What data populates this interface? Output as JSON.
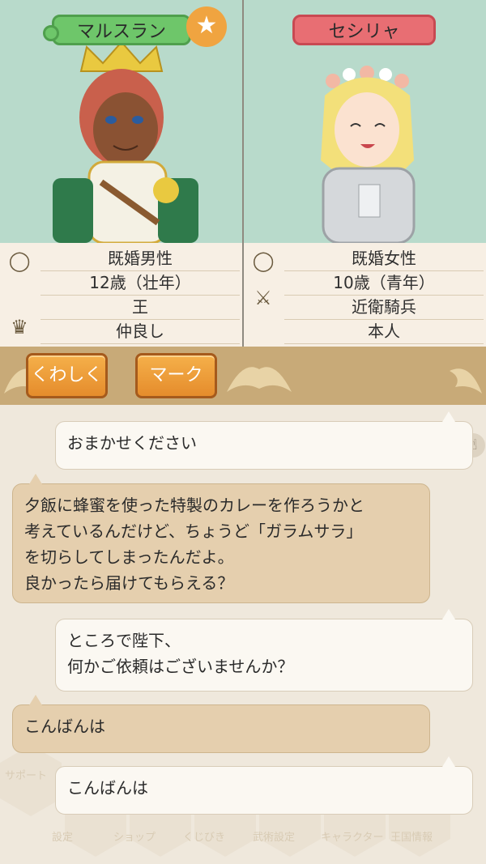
{
  "characters": {
    "left": {
      "name": "マルスラン",
      "badge": "★",
      "info": [
        "既婚男性",
        "12歳（壮年）",
        "王",
        "仲良し"
      ],
      "icons": [
        "ring-icon",
        "crown-icon"
      ]
    },
    "right": {
      "name": "セシリャ",
      "info": [
        "既婚女性",
        "10歳（青年）",
        "近衛騎兵",
        "本人"
      ],
      "icons": [
        "ring-icon",
        "crossed-swords-icon"
      ]
    }
  },
  "buttons": {
    "details": "くわしく",
    "mark": "マーク"
  },
  "chat": {
    "messages": [
      {
        "side": "right",
        "lines": [
          "おまかせください"
        ]
      },
      {
        "side": "left",
        "lines": [
          "夕飯に蜂蜜を使った特製のカレーを作ろうかと",
          "考えているんだけど、ちょうど「ガラムサラ」",
          "を切らしてしまったんだよ。",
          "良かったら届けてもらえる？"
        ]
      },
      {
        "side": "right",
        "lines": [
          "ところで陛下、",
          "何かご依頼はございませんか？"
        ]
      },
      {
        "side": "left",
        "lines": [
          "こんばんは"
        ]
      },
      {
        "side": "right",
        "lines": [
          "こんばんは"
        ]
      }
    ]
  },
  "background_menu": [
    "サポート",
    "設定",
    "ショップ",
    "くじびき",
    "武術設定",
    "キャラクター",
    "王国情報"
  ],
  "colors": {
    "portrait_bg": "#b8dacb",
    "name_green": "#6ec66a",
    "name_red": "#e86e73",
    "button_orange": "#f0a040",
    "bar_tan": "#c8aa78"
  }
}
